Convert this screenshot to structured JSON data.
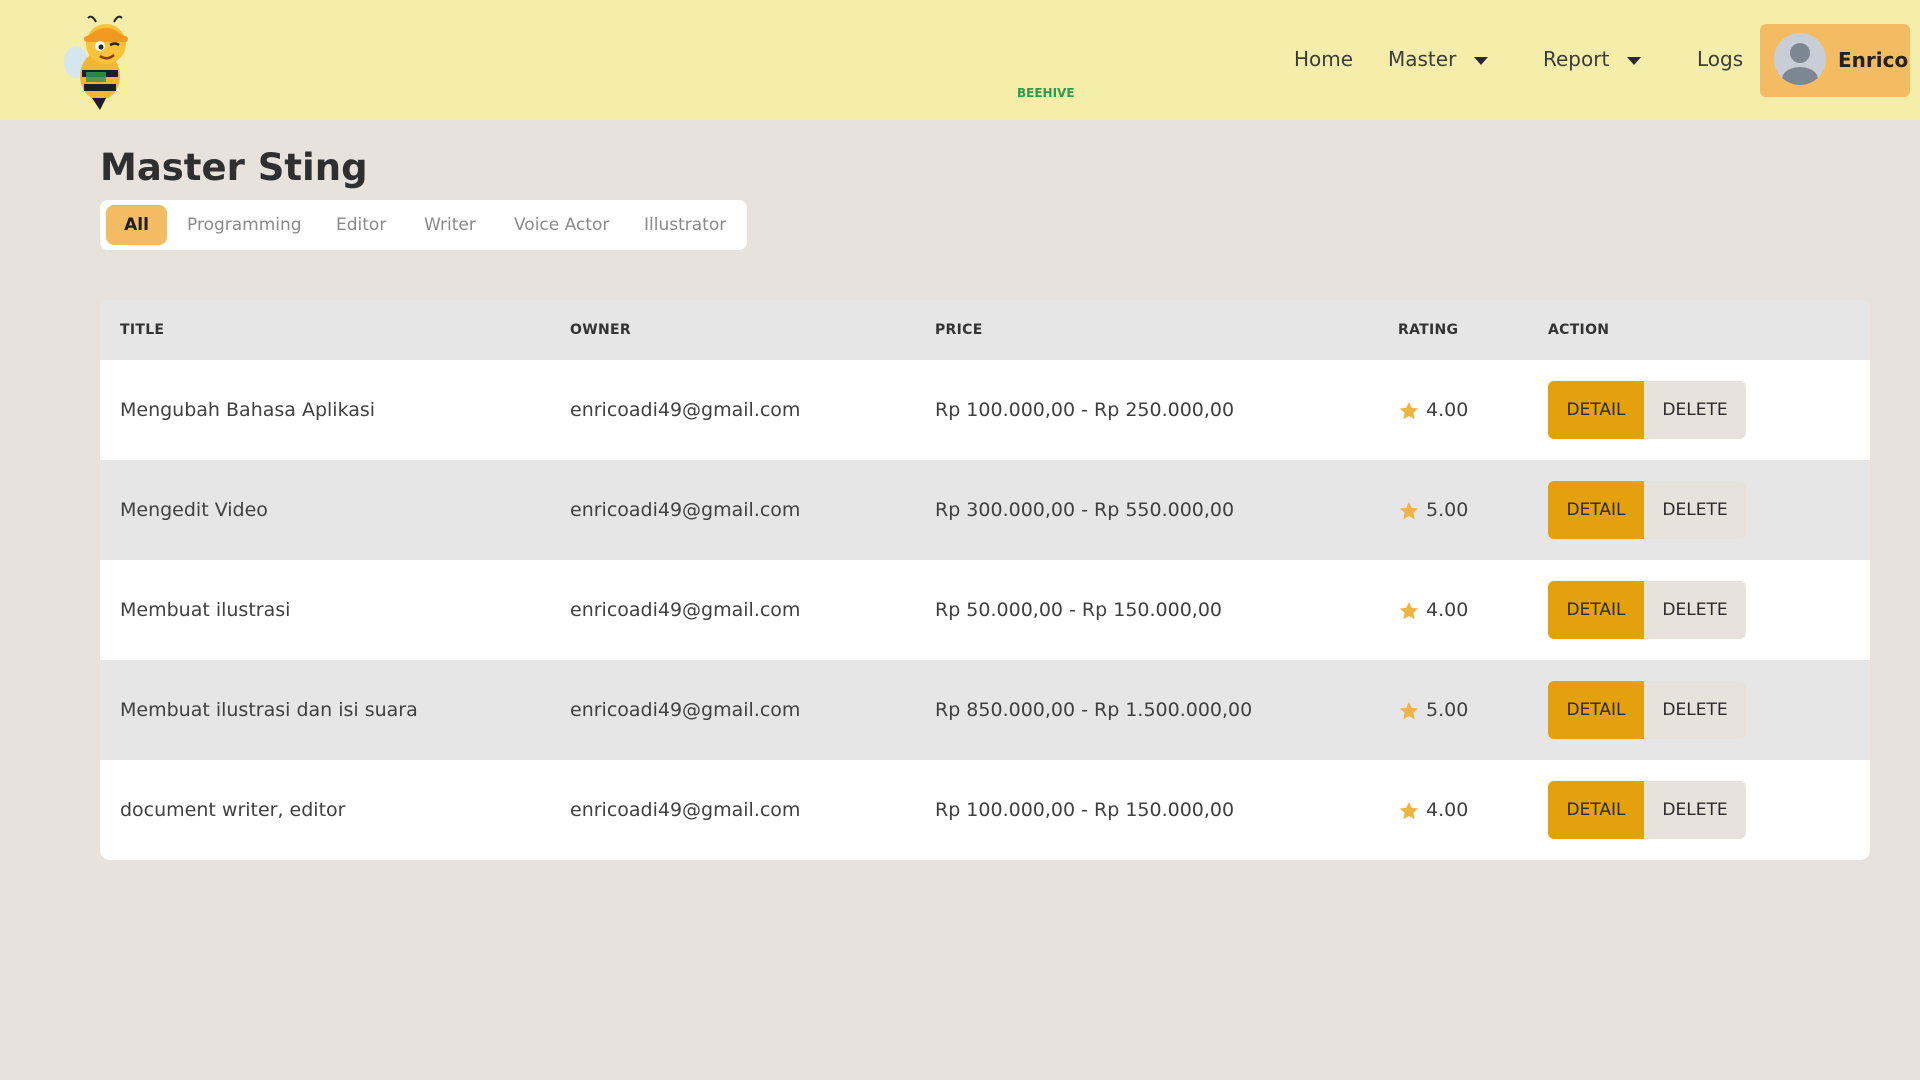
{
  "brand": {
    "logo_text": "BEEHIVE",
    "accent": "#f3bc62",
    "header_bg": "#f5eeaa",
    "detail_color": "#e4a10c",
    "star_color": "#f0b444"
  },
  "nav": {
    "home": "Home",
    "master": "Master",
    "report": "Report",
    "logs": "Logs",
    "user_name": "Enrico"
  },
  "page": {
    "title": "Master Sting"
  },
  "tabs": [
    "All",
    "Programming",
    "Editor",
    "Writer",
    "Voice Actor",
    "Illustrator"
  ],
  "table": {
    "headers": {
      "title": "TITLE",
      "owner": "OWNER",
      "price": "PRICE",
      "rating": "RATING",
      "action": "ACTION"
    },
    "rows": [
      {
        "title": "Mengubah Bahasa Aplikasi",
        "owner": "enricoadi49@gmail.com",
        "price": "Rp 100.000,00 - Rp 250.000,00",
        "rating": "4.00"
      },
      {
        "title": "Mengedit Video",
        "owner": "enricoadi49@gmail.com",
        "price": "Rp 300.000,00 - Rp 550.000,00",
        "rating": "5.00"
      },
      {
        "title": "Membuat ilustrasi",
        "owner": "enricoadi49@gmail.com",
        "price": "Rp 50.000,00 - Rp 150.000,00",
        "rating": "4.00"
      },
      {
        "title": "Membuat ilustrasi dan isi suara",
        "owner": "enricoadi49@gmail.com",
        "price": "Rp 850.000,00 - Rp 1.500.000,00",
        "rating": "5.00"
      },
      {
        "title": "document writer, editor",
        "owner": "enricoadi49@gmail.com",
        "price": "Rp 100.000,00 - Rp 150.000,00",
        "rating": "4.00"
      }
    ],
    "detail_label": "DETAIL",
    "delete_label": "DELETE"
  }
}
